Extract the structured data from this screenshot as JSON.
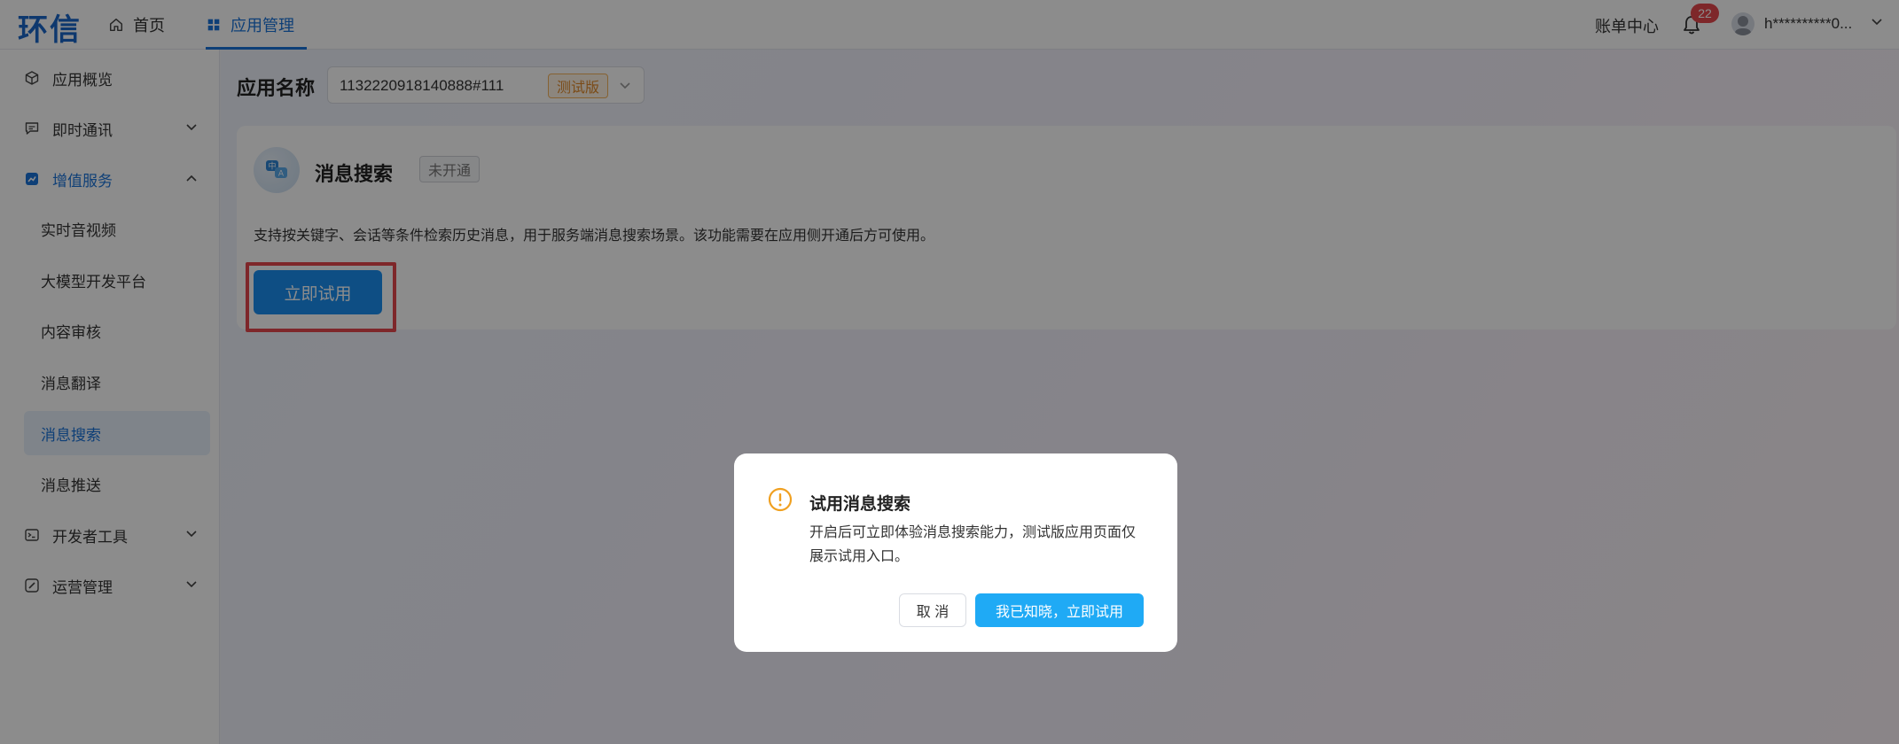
{
  "header": {
    "logo": "环信",
    "nav": [
      {
        "label": "首页",
        "icon": "home-icon"
      },
      {
        "label": "应用管理",
        "icon": "grid-icon"
      }
    ],
    "billing_label": "账单中心",
    "notification_count": "22",
    "username": "h**********0..."
  },
  "sidebar": {
    "items": [
      {
        "label": "应用概览",
        "icon": "cube-icon"
      },
      {
        "label": "即时通讯",
        "icon": "chat-icon"
      },
      {
        "label": "增值服务",
        "icon": "chart-icon"
      },
      {
        "label": "开发者工具",
        "icon": "terminal-icon"
      },
      {
        "label": "运营管理",
        "icon": "edit-icon"
      }
    ],
    "sub_items": [
      {
        "label": "实时音视频"
      },
      {
        "label": "大模型开发平台"
      },
      {
        "label": "内容审核"
      },
      {
        "label": "消息翻译"
      },
      {
        "label": "消息搜索"
      },
      {
        "label": "消息推送"
      }
    ]
  },
  "main": {
    "app_label": "应用名称",
    "app_select_value": "1132220918140888#111",
    "app_tag": "测试版",
    "card": {
      "title": "消息搜索",
      "status": "未开通",
      "description": "支持按关键字、会话等条件检索历史消息，用于服务端消息搜索场景。该功能需要在应用侧开通后方可使用。",
      "try_button": "立即试用"
    }
  },
  "dialog": {
    "title": "试用消息搜索",
    "body": "开启后可立即体验消息搜索能力，测试版应用页面仅展示试用入口。",
    "cancel": "取 消",
    "confirm": "我已知晓，立即试用"
  },
  "colors": {
    "brand": "#1a66c9",
    "accent": "#1a73d9",
    "primary_button": "#1a8ff0",
    "dialog_confirm": "#1faaf5",
    "warning": "#f0a020",
    "highlight": "#e5484d"
  }
}
